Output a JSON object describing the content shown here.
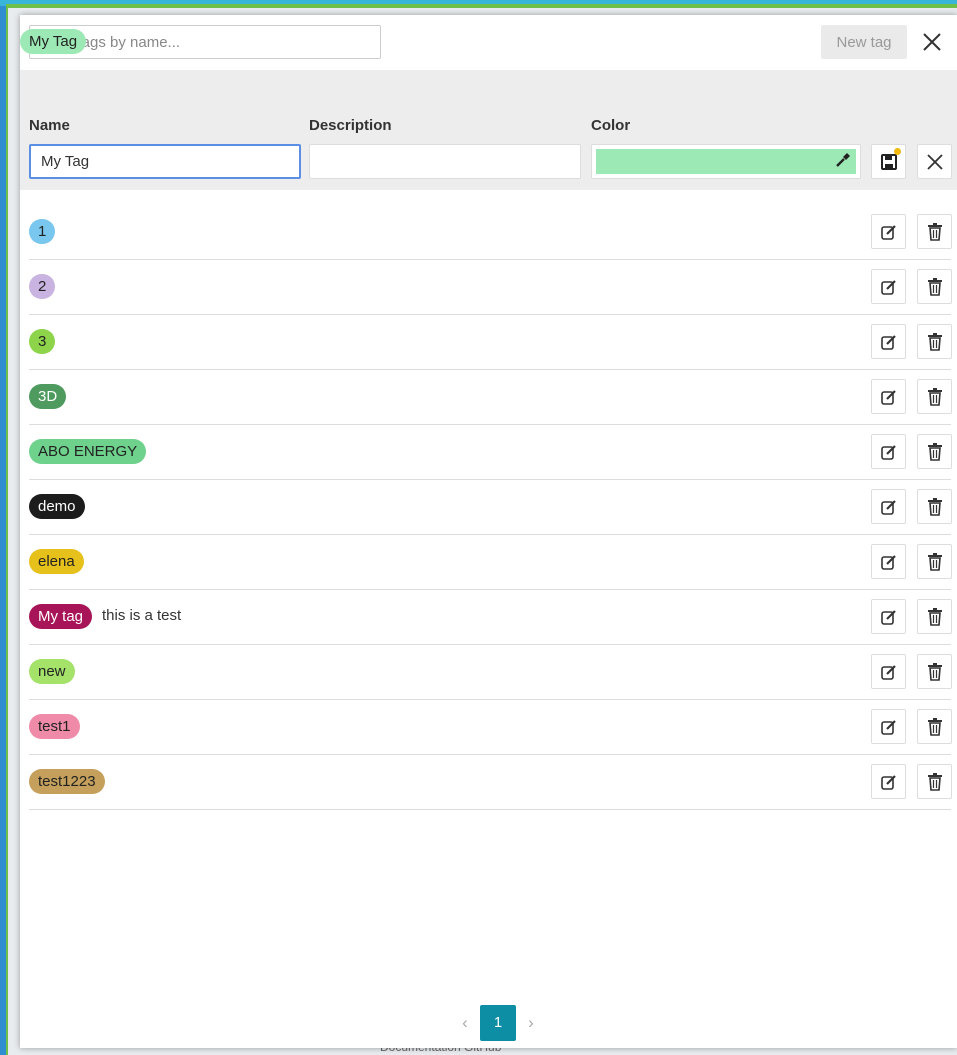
{
  "background": {
    "footer_text": "Documentation    GitHub"
  },
  "toolbar": {
    "filter_placeholder": "Filter tags by name...",
    "filter_value": "",
    "new_tag_label": "New tag",
    "close_icon": "close-icon"
  },
  "editor": {
    "preview_label": "My Tag",
    "preview_color": "#9de9b5",
    "name_label": "Name",
    "description_label": "Description",
    "color_label": "Color",
    "name_value": "My Tag",
    "description_value": "",
    "color_value": "#9de9b5",
    "save_icon": "floppy-disk-icon",
    "cancel_icon": "close-icon"
  },
  "tags": [
    {
      "label": "1",
      "color": "#79c6ee",
      "text_color": "#222",
      "description": ""
    },
    {
      "label": "2",
      "color": "#c9b3e0",
      "text_color": "#222",
      "description": ""
    },
    {
      "label": "3",
      "color": "#8ed44a",
      "text_color": "#222",
      "description": ""
    },
    {
      "label": "3D",
      "color": "#4f9a5f",
      "text_color": "#ffffff",
      "description": ""
    },
    {
      "label": "ABO ENERGY",
      "color": "#6ed28c",
      "text_color": "#222",
      "description": ""
    },
    {
      "label": "demo",
      "color": "#1c1c1c",
      "text_color": "#ffffff",
      "description": ""
    },
    {
      "label": "elena",
      "color": "#e6c01b",
      "text_color": "#222",
      "description": ""
    },
    {
      "label": "My tag",
      "color": "#a81458",
      "text_color": "#ffffff",
      "description": "this is a test"
    },
    {
      "label": "new",
      "color": "#a4e26a",
      "text_color": "#222",
      "description": ""
    },
    {
      "label": "test1",
      "color": "#ef8aa8",
      "text_color": "#222",
      "description": ""
    },
    {
      "label": "test1223",
      "color": "#c4a05c",
      "text_color": "#222",
      "description": ""
    }
  ],
  "pagination": {
    "current_page": "1",
    "prev_icon": "chevron-left-icon",
    "next_icon": "chevron-right-icon"
  }
}
